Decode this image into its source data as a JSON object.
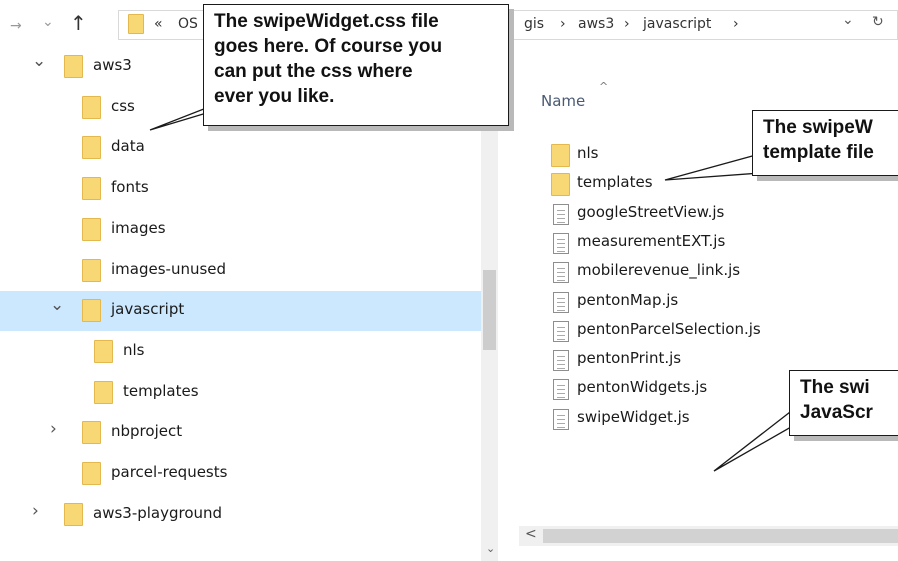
{
  "address_bar": {
    "back_arrow": "→",
    "dropdown_arrow": "⌄",
    "up_arrow": "↑",
    "overflow_chevron": "«",
    "path_prefix": "OS",
    "path": [
      "gis",
      "aws3",
      "javascript"
    ],
    "separator": "›",
    "path_dropdown": "⌄",
    "refresh": "↻"
  },
  "tree": [
    {
      "label": "aws3",
      "expanded": true,
      "level": 0,
      "selected": false
    },
    {
      "label": "css",
      "expanded": false,
      "level": 1,
      "selected": false
    },
    {
      "label": "data",
      "expanded": false,
      "level": 1,
      "selected": false
    },
    {
      "label": "fonts",
      "expanded": false,
      "level": 1,
      "selected": false
    },
    {
      "label": "images",
      "expanded": false,
      "level": 1,
      "selected": false
    },
    {
      "label": "images-unused",
      "expanded": false,
      "level": 1,
      "selected": false
    },
    {
      "label": "javascript",
      "expanded": true,
      "level": 1,
      "selected": true
    },
    {
      "label": "nls",
      "expanded": false,
      "level": 2,
      "selected": false
    },
    {
      "label": "templates",
      "expanded": false,
      "level": 2,
      "selected": false
    },
    {
      "label": "nbproject",
      "expanded": false,
      "level": 1,
      "selected": false
    },
    {
      "label": "parcel-requests",
      "expanded": false,
      "level": 1,
      "selected": false
    },
    {
      "label": "aws3-playground",
      "expanded": false,
      "level": 0,
      "selected": false
    }
  ],
  "list": {
    "column_header": "Name",
    "sort_caret": "^",
    "items": [
      {
        "name": "nls",
        "type": "folder"
      },
      {
        "name": "templates",
        "type": "folder"
      },
      {
        "name": "googleStreetView.js",
        "type": "file"
      },
      {
        "name": "measurementEXT.js",
        "type": "file"
      },
      {
        "name": "mobilerevenue_link.js",
        "type": "file"
      },
      {
        "name": "pentonMap.js",
        "type": "file"
      },
      {
        "name": "pentonParcelSelection.js",
        "type": "file"
      },
      {
        "name": "pentonPrint.js",
        "type": "file"
      },
      {
        "name": "pentonWidgets.js",
        "type": "file"
      },
      {
        "name": "swipeWidget.js",
        "type": "file"
      }
    ],
    "hscroll_left": "<"
  },
  "left_scroll_down": "⌄",
  "callouts": {
    "css": [
      "The swipeWidget.css file",
      "goes here. Of course you",
      "can put the css where",
      "ever you like."
    ],
    "template": [
      "The swipeW",
      "template file"
    ],
    "js": [
      "The swi",
      "JavaScr"
    ]
  },
  "colors": {
    "selection": "#cce8ff",
    "folder": "#f8d775",
    "scrollbar": "#f0f0f0"
  }
}
